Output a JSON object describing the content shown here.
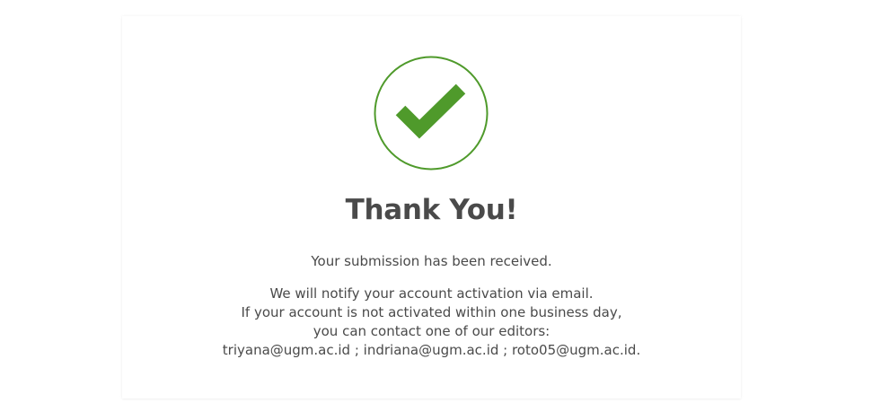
{
  "confirmation": {
    "icon": "check-circle-icon",
    "accent_color": "#4f9a2b",
    "title": "Thank You!",
    "received_message": "Your submission has been received.",
    "notice_lines": [
      "We will notify your account activation via email.",
      "If your account is not activated within one business day,",
      "you can contact one of our editors:",
      "triyana@ugm.ac.id ; indriana@ugm.ac.id ; roto05@ugm.ac.id."
    ]
  }
}
